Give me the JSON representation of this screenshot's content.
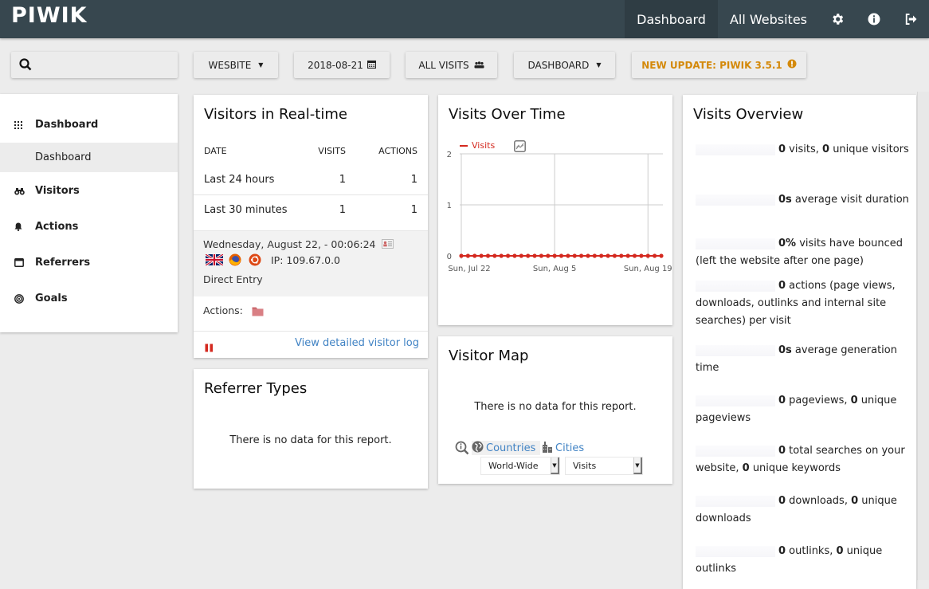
{
  "app": {
    "logo": "PIWIK"
  },
  "topnav": {
    "items": [
      {
        "label": "Dashboard",
        "active": true
      },
      {
        "label": "All Websites",
        "active": false
      }
    ],
    "icons": [
      "gear-icon",
      "info-icon",
      "sign-out-icon"
    ]
  },
  "toolbar": {
    "search_placeholder": "",
    "website_label": "WESBITE",
    "date_label": "2018-08-21",
    "segment_label": "ALL VISITS",
    "dashboard_label": "DASHBOARD",
    "update_label": "NEW UPDATE: PIWIK 3.5.1",
    "update_color": "#d4890a"
  },
  "sidebar": {
    "items": [
      {
        "label": "Dashboard",
        "icon": "grid-icon"
      },
      {
        "label": "Visitors",
        "icon": "binoculars-icon"
      },
      {
        "label": "Actions",
        "icon": "bell-icon"
      },
      {
        "label": "Referrers",
        "icon": "window-icon"
      },
      {
        "label": "Goals",
        "icon": "target-icon"
      }
    ],
    "subitem": "Dashboard"
  },
  "realtime": {
    "title": "Visitors in Real-time",
    "headers": {
      "date": "DATE",
      "visits": "VISITS",
      "actions": "ACTIONS"
    },
    "rows": [
      {
        "date": "Last 24 hours",
        "visits": "1",
        "actions": "1"
      },
      {
        "date": "Last 30 minutes",
        "visits": "1",
        "actions": "1"
      }
    ],
    "visit": {
      "datetime": "Wednesday, August 22, - 00:06:24",
      "ip": "IP: 109.67.0.0",
      "referrer": "Direct Entry",
      "actions_label": "Actions:"
    },
    "log_link": "View detailed visitor log"
  },
  "referrer_types": {
    "title": "Referrer Types",
    "no_data": "There is no data for this report."
  },
  "visits_over_time": {
    "title": "Visits Over Time",
    "legend": "Visits",
    "series_color": "#d4291f"
  },
  "chart_data": {
    "type": "line",
    "title": "Visits Over Time",
    "xlabel": "",
    "ylabel": "",
    "ylim": [
      0,
      2
    ],
    "yticks": [
      "0",
      "1",
      "2"
    ],
    "xticks": [
      "Sun, Jul 22",
      "Sun, Aug 5",
      "Sun, Aug 19"
    ],
    "grid": true,
    "legend": "top-left",
    "series": [
      {
        "name": "Visits",
        "values": [
          0,
          0,
          0,
          0,
          0,
          0,
          0,
          0,
          0,
          0,
          0,
          0,
          0,
          0,
          0,
          0,
          0,
          0,
          0,
          0,
          0,
          0,
          0,
          0,
          0,
          0,
          0,
          0,
          0,
          0,
          0
        ]
      }
    ]
  },
  "visitor_map": {
    "title": "Visitor Map",
    "no_data": "There is no data for this report.",
    "countries_label": "Countries",
    "cities_label": "Cities",
    "region_select": "World-Wide",
    "metric_select": "Visits"
  },
  "overview": {
    "title": "Visits Overview",
    "items": [
      {
        "parts": [
          {
            "b": "0"
          },
          {
            "t": " visits, "
          },
          {
            "b": "0"
          },
          {
            "t": " unique visitors"
          }
        ]
      },
      {
        "parts": [
          {
            "b": "0s"
          },
          {
            "t": " average visit duration"
          }
        ]
      },
      {
        "parts": [
          {
            "b": "0%"
          },
          {
            "t": " visits have bounced (left the website after one page)"
          }
        ]
      },
      {
        "parts": [
          {
            "b": "0"
          },
          {
            "t": " actions (page views, downloads, outlinks and internal site searches) per visit"
          }
        ]
      },
      {
        "parts": [
          {
            "b": "0s"
          },
          {
            "t": " average generation time"
          }
        ]
      },
      {
        "parts": [
          {
            "b": "0"
          },
          {
            "t": " pageviews, "
          },
          {
            "b": "0"
          },
          {
            "t": " unique pageviews"
          }
        ]
      },
      {
        "parts": [
          {
            "b": "0"
          },
          {
            "t": " total searches on your website, "
          },
          {
            "b": "0"
          },
          {
            "t": " unique keywords"
          }
        ]
      },
      {
        "parts": [
          {
            "b": "0"
          },
          {
            "t": " downloads, "
          },
          {
            "b": "0"
          },
          {
            "t": " unique downloads"
          }
        ]
      },
      {
        "parts": [
          {
            "b": "0"
          },
          {
            "t": " outlinks, "
          },
          {
            "b": "0"
          },
          {
            "t": " unique outlinks"
          }
        ]
      }
    ]
  }
}
